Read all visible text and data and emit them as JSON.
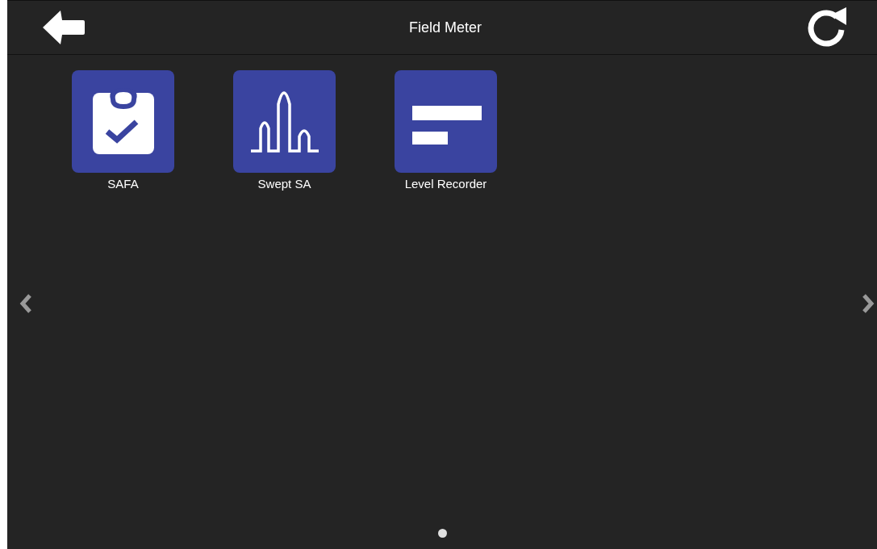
{
  "header": {
    "title": "Field Meter"
  },
  "apps": [
    {
      "label": "SAFA",
      "kind": "clipboard"
    },
    {
      "label": "Swept SA",
      "kind": "spectrum"
    },
    {
      "label": "Level Recorder",
      "kind": "bars"
    }
  ],
  "pages": [
    {
      "selected": true
    }
  ]
}
